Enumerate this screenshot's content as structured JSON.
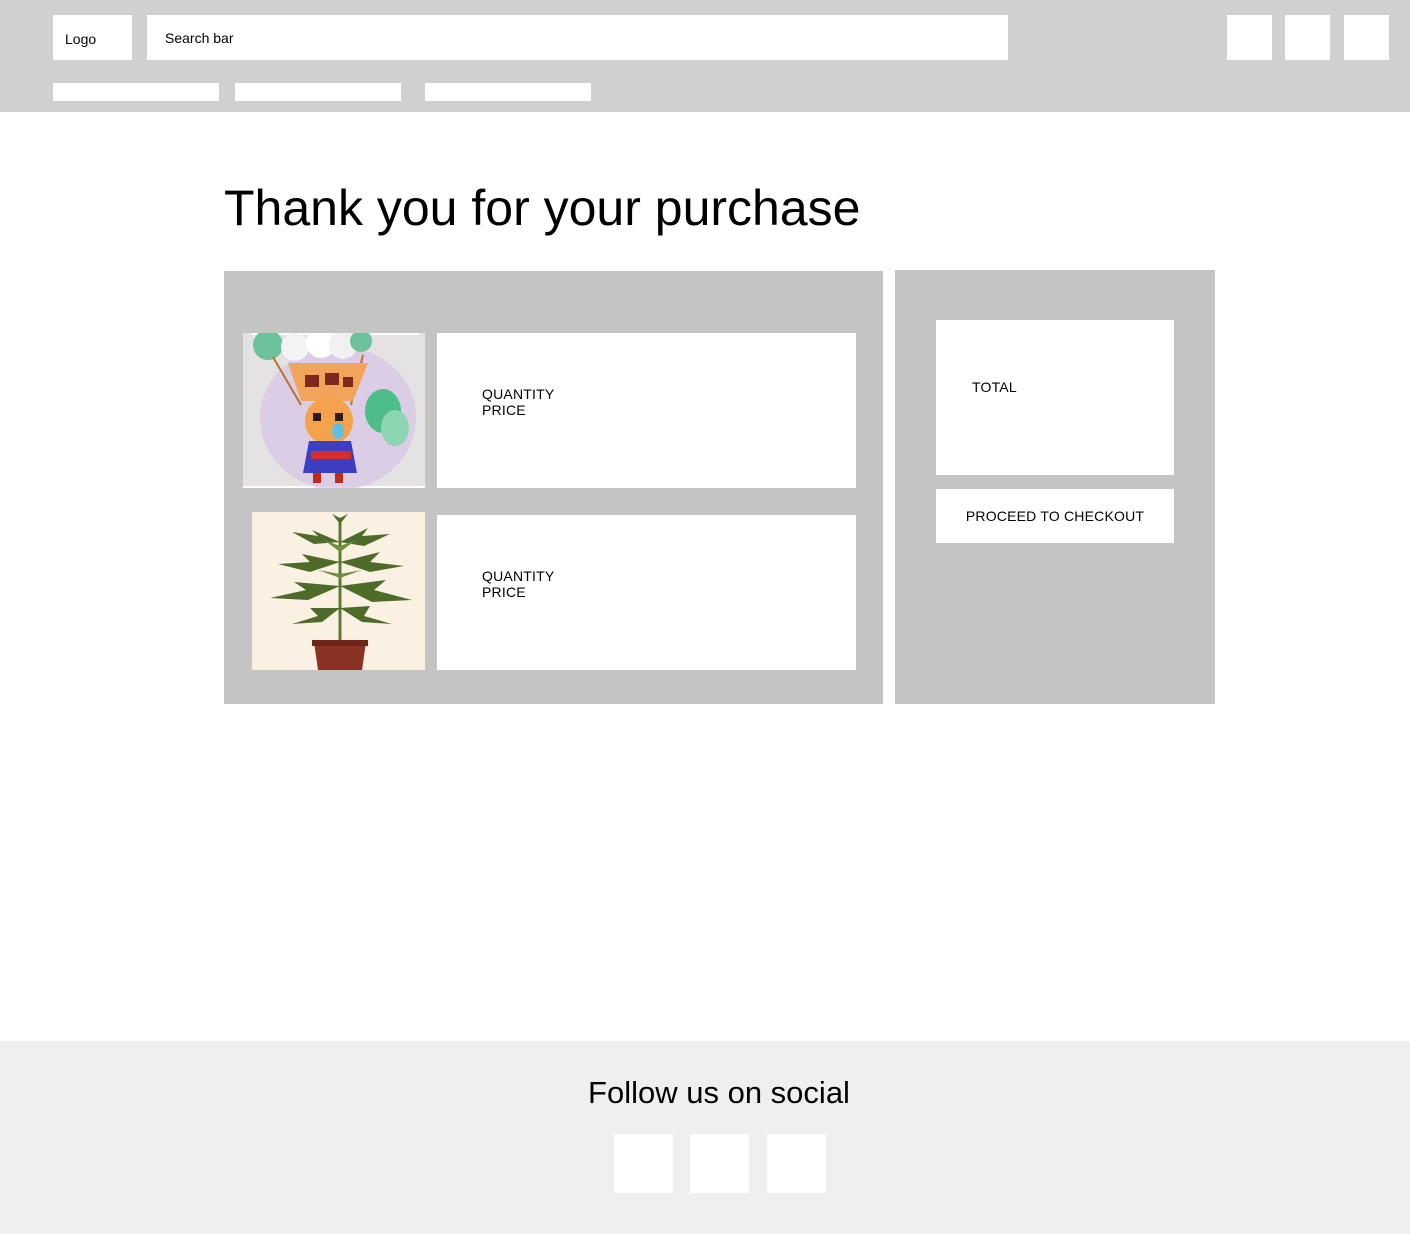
{
  "header": {
    "logo_label": "Logo",
    "search_placeholder": "Search bar"
  },
  "main": {
    "title": "Thank you for your purchase"
  },
  "cart": {
    "items": [
      {
        "quantity_label": "QUANTITY",
        "price_label": "PRICE",
        "image": "cartoon-character-sticker-image"
      },
      {
        "quantity_label": "QUANTITY",
        "price_label": "PRICE",
        "image": "potted-plant-image"
      }
    ]
  },
  "summary": {
    "total_label": "TOTAL",
    "checkout_label": "PROCEED TO CHECKOUT"
  },
  "footer": {
    "title": "Follow us on social"
  },
  "colors": {
    "header_bg": "#d0d0d0",
    "panel_bg": "#c4c4c4",
    "footer_bg": "#efefef"
  }
}
